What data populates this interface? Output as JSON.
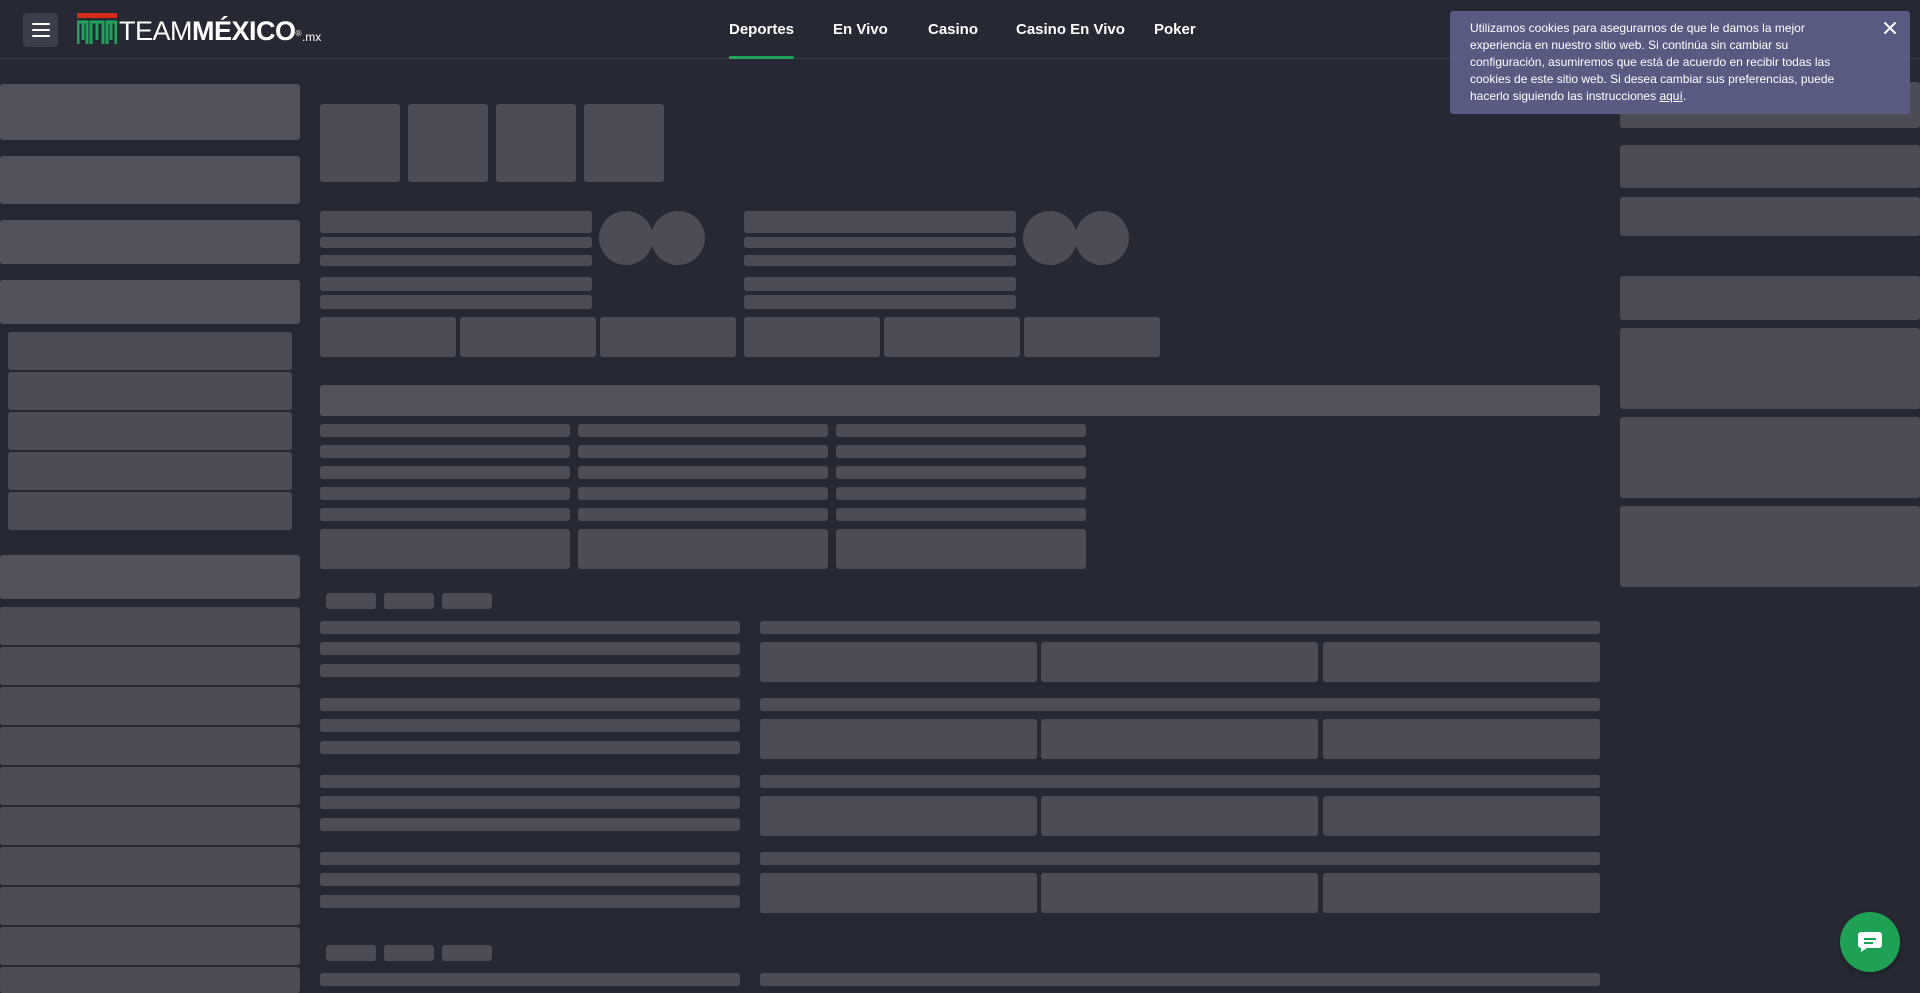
{
  "brand": {
    "name_thin": "TEAM",
    "name_bold": "MÉXICO",
    "registered": "®",
    "tld": ".mx",
    "colors": {
      "green": "#1fa35c",
      "red": "#d52b1e",
      "white": "#ffffff"
    }
  },
  "nav": {
    "items": [
      {
        "label": "Deportes",
        "active": true
      },
      {
        "label": "En Vivo",
        "active": false
      },
      {
        "label": "Casino",
        "active": false
      },
      {
        "label": "Casino En Vivo",
        "active": false
      },
      {
        "label": "Poker",
        "active": false
      }
    ]
  },
  "cookie": {
    "text": "Utilizamos cookies para asegurarnos de que le damos la mejor experiencia en nuestro sitio web. Si continúa sin cambiar su configuración, asumiremos que está de acuerdo en recibir todas las cookies de este sitio web. Si desea cambiar sus preferencias, puede hacerlo siguiendo las instrucciones ",
    "link": "aquí",
    "end": ".",
    "close_icon": "close-icon"
  },
  "chat": {
    "icon": "chat-bubble-icon"
  },
  "menu": {
    "icon": "hamburger-menu-icon"
  },
  "theme": {
    "background": "#262833",
    "skeleton": "#4b4c56",
    "accent": "#1fa35c",
    "cookie_bg": "#595a82",
    "chat_bg": "#1ea055"
  }
}
